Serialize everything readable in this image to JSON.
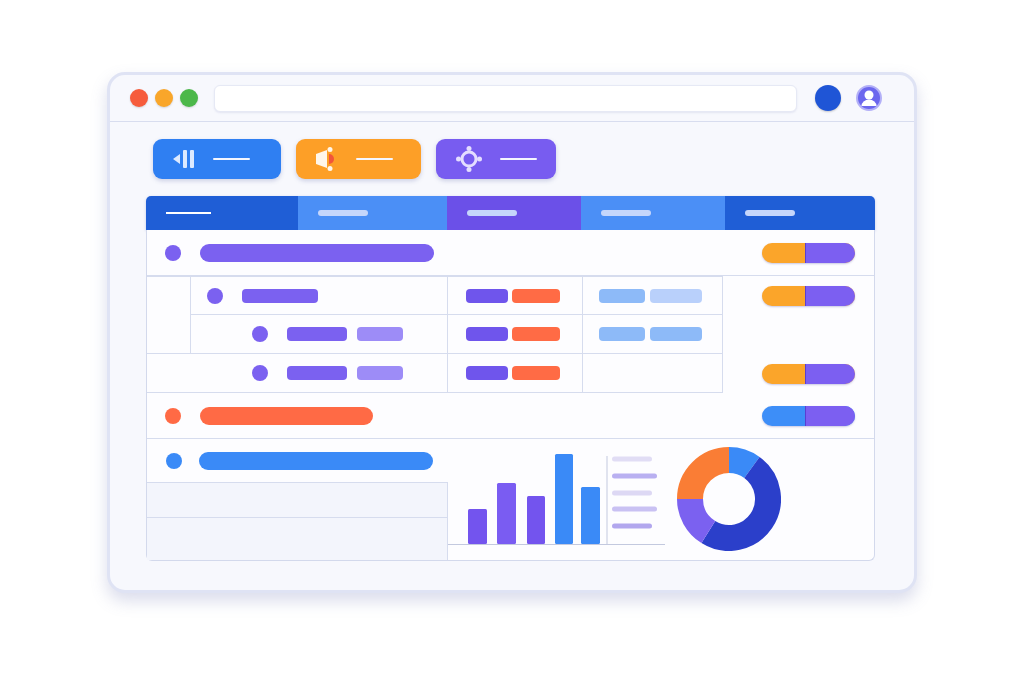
{
  "window": {
    "controls": [
      {
        "color": "#f65c3c"
      },
      {
        "color": "#f9a62a"
      },
      {
        "color": "#4cb84a"
      }
    ]
  },
  "toolbar": [
    {
      "kind": "signal",
      "color": "#2f7ff2"
    },
    {
      "kind": "megaphone",
      "color": "#fd9f27"
    },
    {
      "kind": "target",
      "color": "#785cf0"
    }
  ],
  "tabs": [
    {
      "selected": true,
      "color": "#1f5ed6"
    },
    {
      "selected": false,
      "color": "#4b8ff6"
    },
    {
      "selected": false,
      "color": "#6b50e8"
    },
    {
      "selected": false,
      "color": "#4b8ff6"
    },
    {
      "selected": false,
      "color": "#1f5ed6"
    }
  ],
  "rows": [
    {
      "kind": "summary",
      "color": "#7b61f0",
      "tag": {
        "color": "#fba52a"
      },
      "children": [
        {
          "kind": "full",
          "color": "#7b61f0",
          "tag": {
            "color": "#fba52a"
          },
          "children": [
            {
              "kind": "full",
              "color": "#7b61f0"
            }
          ]
        },
        {
          "kind": "partial",
          "color": "#7b61f0",
          "tag": {
            "color": "#fba52a"
          }
        }
      ]
    },
    {
      "kind": "summary",
      "color": "#ff6a45",
      "tag": {
        "color": "#3d8ef8"
      }
    },
    {
      "kind": "overview",
      "color": "#3a8af7"
    }
  ]
}
